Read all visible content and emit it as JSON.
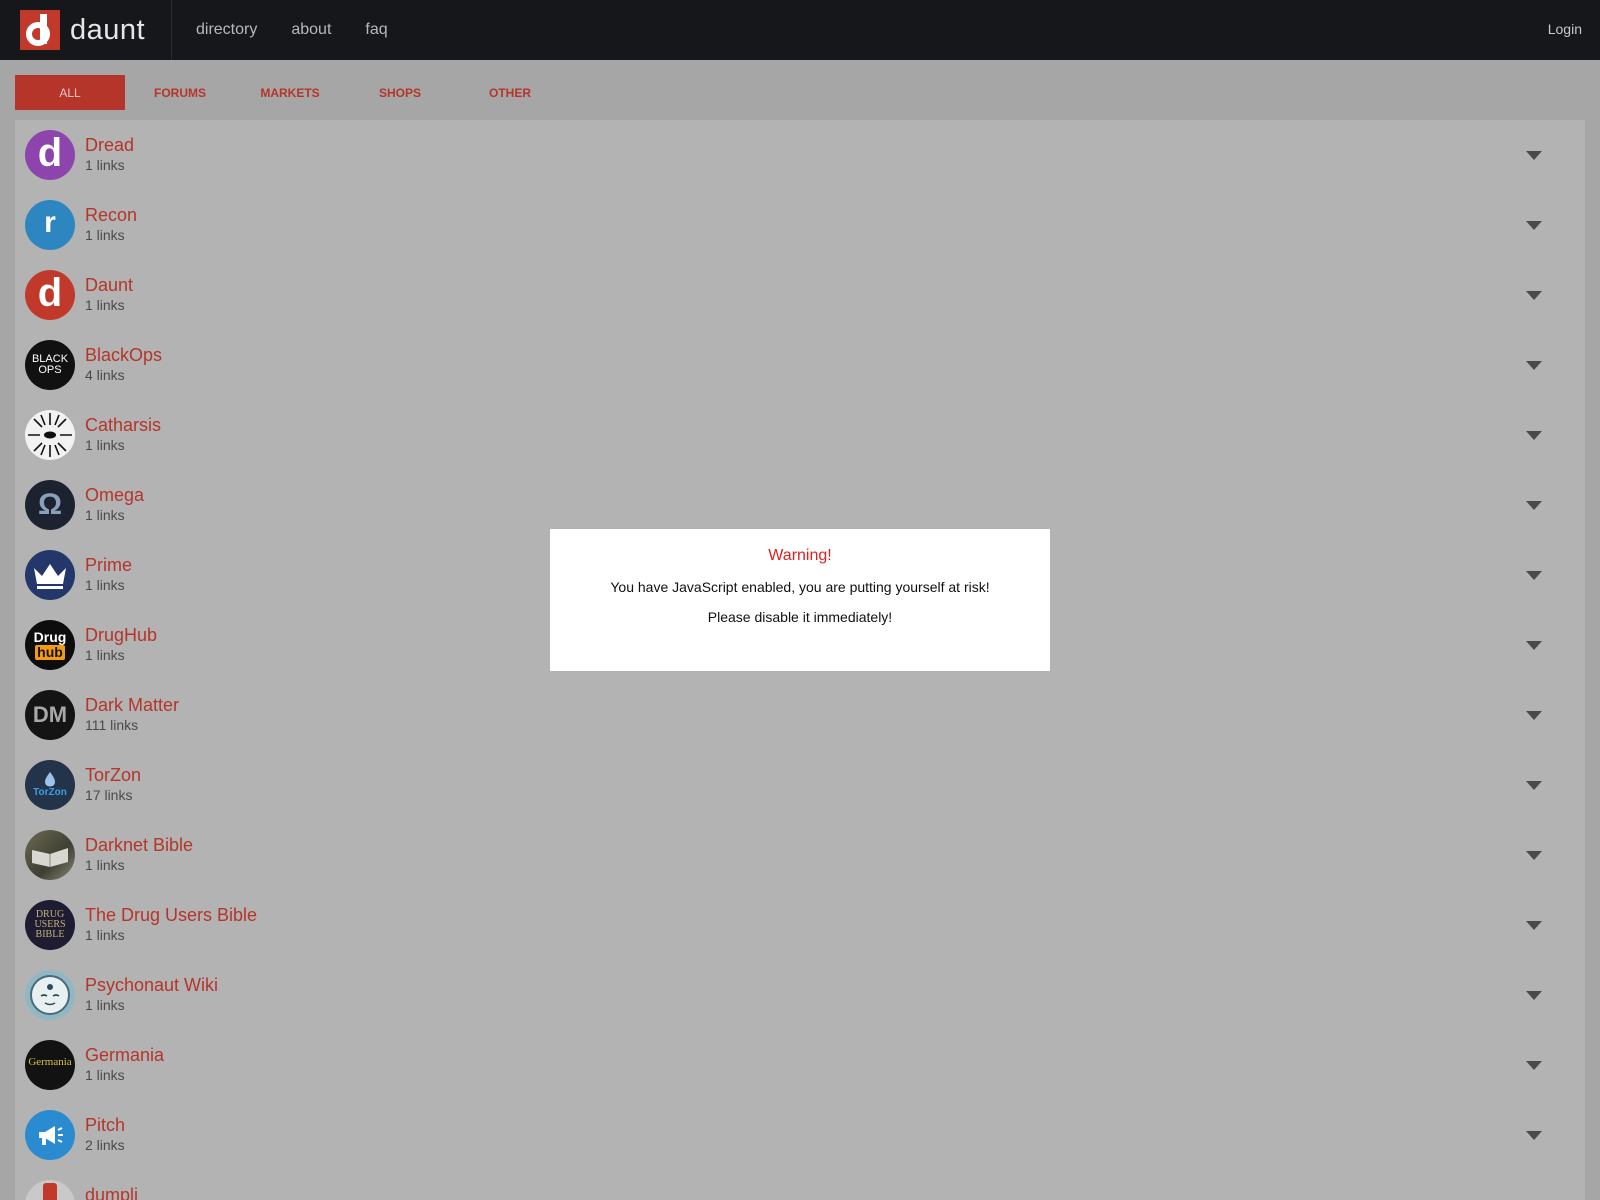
{
  "brand": {
    "name": "daunt",
    "logo_icon": "daunt-d-logo-icon",
    "accent": "#c0392b"
  },
  "nav": {
    "links": [
      "directory",
      "about",
      "faq"
    ],
    "login": "Login"
  },
  "tabs": [
    {
      "label": "ALL",
      "active": true
    },
    {
      "label": "FORUMS",
      "active": false
    },
    {
      "label": "MARKETS",
      "active": false
    },
    {
      "label": "SHOPS",
      "active": false
    },
    {
      "label": "OTHER",
      "active": false
    }
  ],
  "items": [
    {
      "name": "Dread",
      "count": "1 links",
      "icon": "dread-logo-icon",
      "color": "#8e44ad"
    },
    {
      "name": "Recon",
      "count": "1 links",
      "icon": "recon-logo-icon",
      "color": "#2e86c1"
    },
    {
      "name": "Daunt",
      "count": "1 links",
      "icon": "daunt-logo-icon",
      "color": "#c0392b"
    },
    {
      "name": "BlackOps",
      "count": "4 links",
      "icon": "blackops-logo-icon",
      "color": "#111111"
    },
    {
      "name": "Catharsis",
      "count": "1 links",
      "icon": "catharsis-logo-icon",
      "color": "#f2f2f2"
    },
    {
      "name": "Omega",
      "count": "1 links",
      "icon": "omega-logo-icon",
      "color": "#1d2230"
    },
    {
      "name": "Prime",
      "count": "1 links",
      "icon": "prime-crown-icon",
      "color": "#24376a"
    },
    {
      "name": "DrugHub",
      "count": "1 links",
      "icon": "drughub-logo-icon",
      "color": "#0d0d0d"
    },
    {
      "name": "Dark Matter",
      "count": "111 links",
      "icon": "darkmatter-logo-icon",
      "color": "#141414"
    },
    {
      "name": "TorZon",
      "count": "17 links",
      "icon": "torzon-logo-icon",
      "color": "#233349"
    },
    {
      "name": "Darknet Bible",
      "count": "1 links",
      "icon": "book-photo-icon",
      "color": "#5a5a44"
    },
    {
      "name": "The Drug Users Bible",
      "count": "1 links",
      "icon": "drug-users-bible-logo-icon",
      "color": "#1e1c33"
    },
    {
      "name": "Psychonaut Wiki",
      "count": "1 links",
      "icon": "psychonaut-face-icon",
      "color": "#8fb8c4"
    },
    {
      "name": "Germania",
      "count": "1 links",
      "icon": "germania-logo-icon",
      "color": "#121212"
    },
    {
      "name": "Pitch",
      "count": "2 links",
      "icon": "megaphone-icon",
      "color": "#2a8bd0"
    },
    {
      "name": "dumpli",
      "count": "",
      "icon": "dumpli-logo-icon",
      "color": "#c9c9c9"
    }
  ],
  "icon_text": {
    "dread": "d",
    "recon": "r",
    "daunt": "d",
    "blackops_1": "BLACK",
    "blackops_2": "OPS",
    "omega": "Ω",
    "drughub_1": "Drug",
    "drughub_2": "hub",
    "darkmatter": "DM",
    "torzon": "TorZon",
    "dub_1": "DRUG",
    "dub_2": "USERS",
    "dub_3": "BIBLE",
    "germania": "Germania"
  },
  "modal": {
    "title": "Warning!",
    "line1": "You have JavaScript enabled, you are putting yourself at risk!",
    "line2": "Please disable it immediately!"
  }
}
